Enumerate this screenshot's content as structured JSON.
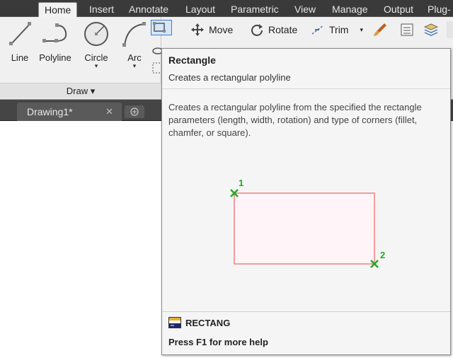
{
  "ribbon": {
    "tabs": [
      {
        "label": "Home",
        "active": true
      },
      {
        "label": "Insert"
      },
      {
        "label": "Annotate"
      },
      {
        "label": "Layout"
      },
      {
        "label": "Parametric"
      },
      {
        "label": "View"
      },
      {
        "label": "Manage"
      },
      {
        "label": "Output"
      },
      {
        "label": "Plug-"
      }
    ]
  },
  "draw_panel": {
    "tools": [
      {
        "label": "Line",
        "icon": "line-icon"
      },
      {
        "label": "Polyline",
        "icon": "polyline-icon"
      },
      {
        "label": "Circle",
        "icon": "circle-icon",
        "dropdown": "▾"
      },
      {
        "label": "Arc",
        "icon": "arc-icon",
        "dropdown": "▾"
      }
    ],
    "footer_label": "Draw",
    "footer_arrow": "▾"
  },
  "modify_panel": {
    "move_label": "Move",
    "rotate_label": "Rotate",
    "trim_label": "Trim",
    "trim_arrow": "▾"
  },
  "document": {
    "tab_label": "Drawing1*",
    "close_glyph": "✕"
  },
  "tooltip": {
    "title": "Rectangle",
    "subtitle": "Creates a rectangular polyline",
    "description": "Creates a rectangular polyline from the specified the rectangle parameters (length, width, rotation) and type of corners (fillet, chamfer, or square).",
    "corner1_label": "1",
    "corner2_label": "2",
    "command": "RECTANG",
    "help": "Press F1 for more help"
  },
  "colors": {
    "rect_stroke": "#f08080",
    "corner_marker": "#22aa22",
    "rect_fill": "#fff5f8"
  }
}
